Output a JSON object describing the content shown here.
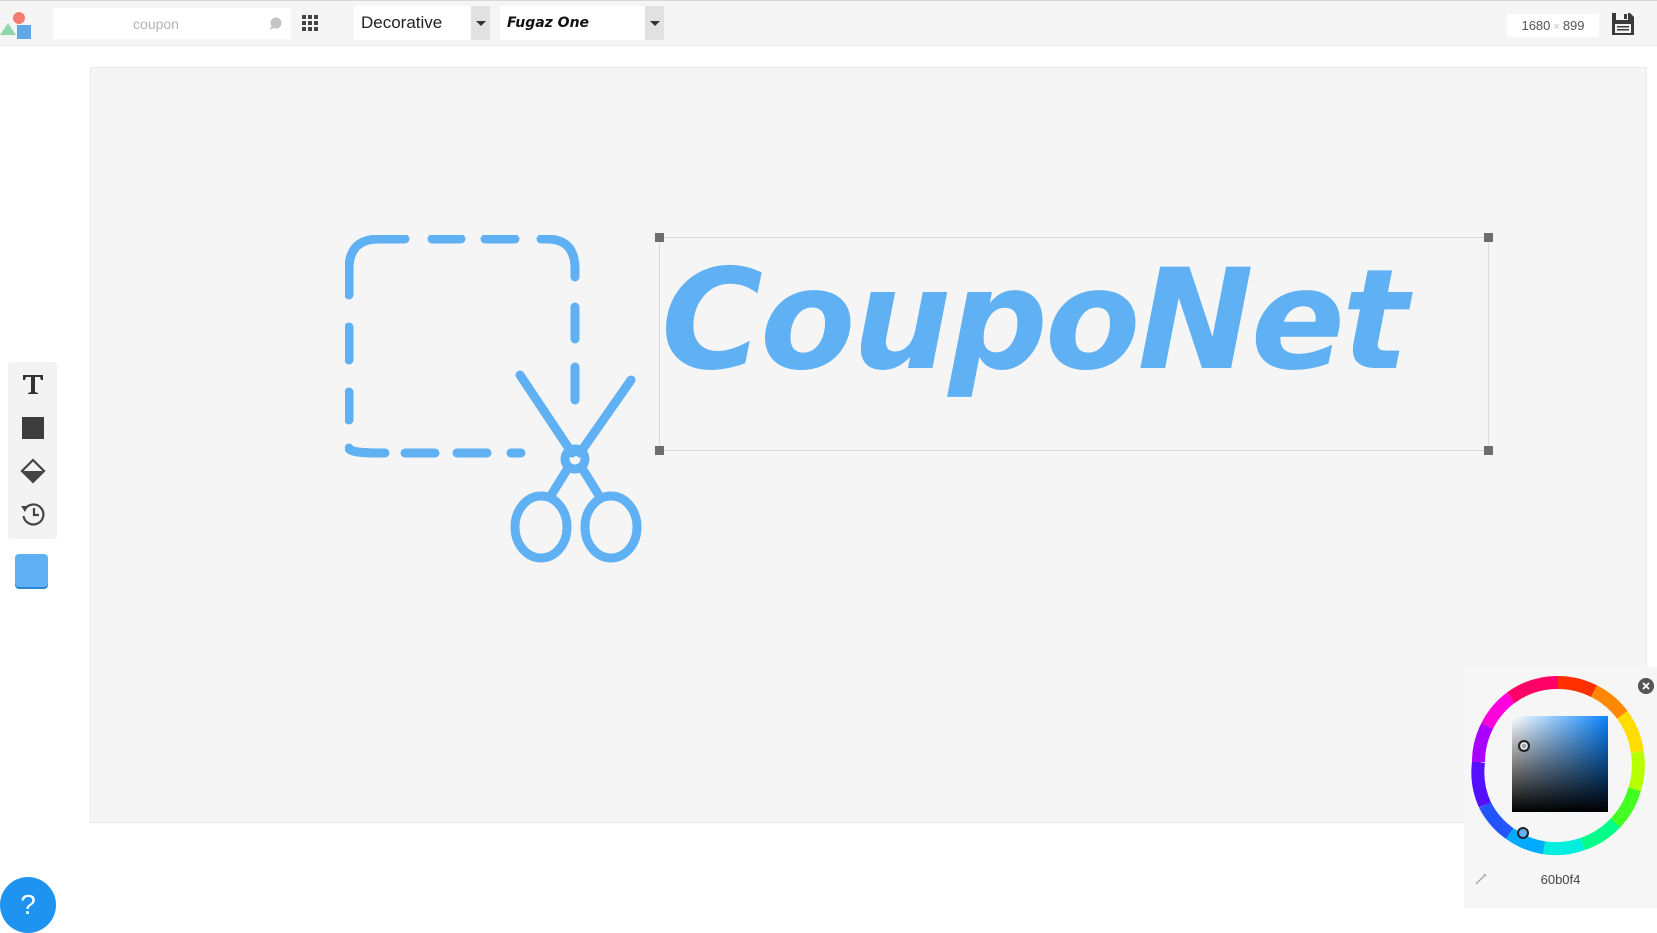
{
  "toolbar": {
    "search": {
      "placeholder": "coupon",
      "value": ""
    },
    "category_select": {
      "value": "Decorative"
    },
    "font_select": {
      "value": "Fugaz One"
    },
    "dimensions": {
      "width": "1680",
      "height": "899"
    }
  },
  "canvas": {
    "logo_text": "CoupoNet",
    "logo_color": "#60b0f4"
  },
  "sidebar": {
    "tools": [
      {
        "icon": "text-icon"
      },
      {
        "icon": "shape-icon"
      },
      {
        "icon": "fill-icon"
      },
      {
        "icon": "history-icon"
      }
    ],
    "current_color": "#60b0f4"
  },
  "help": {
    "label": "?"
  },
  "color_picker": {
    "hex": "60b0f4"
  }
}
